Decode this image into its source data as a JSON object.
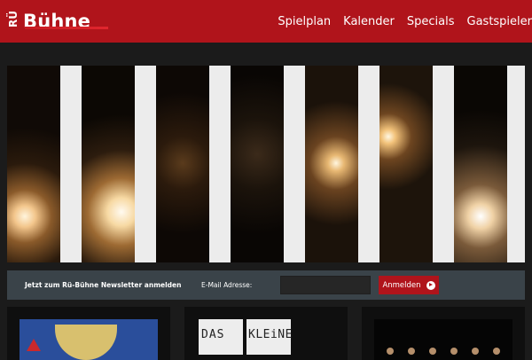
{
  "header": {
    "logo_small": "RÜ",
    "logo_main": "Bühne",
    "nav": [
      {
        "label": "Spielplan"
      },
      {
        "label": "Kalender"
      },
      {
        "label": "Specials"
      },
      {
        "label": "Gastspieler"
      }
    ]
  },
  "hero": {
    "description_icon": "stage-lights-image"
  },
  "newsletter": {
    "title": "Jetzt zum Rü-Bühne Newsletter anmelden",
    "email_label": "E-Mail Adresse:",
    "email_value": "",
    "button_label": "Anmelden",
    "button_icon": "arrow-right-circle-icon"
  },
  "cards": [
    {
      "icon": "poster-image"
    },
    {
      "icon": "das-kleine-poster-image",
      "caption": "DAS KLEINE"
    },
    {
      "icon": "ensemble-photo-image"
    }
  ],
  "colors": {
    "brand_red": "#b0141b",
    "header_bg": "#b0141b",
    "body_bg": "#1b1b1b",
    "newsletter_bg": "#3a4349"
  }
}
